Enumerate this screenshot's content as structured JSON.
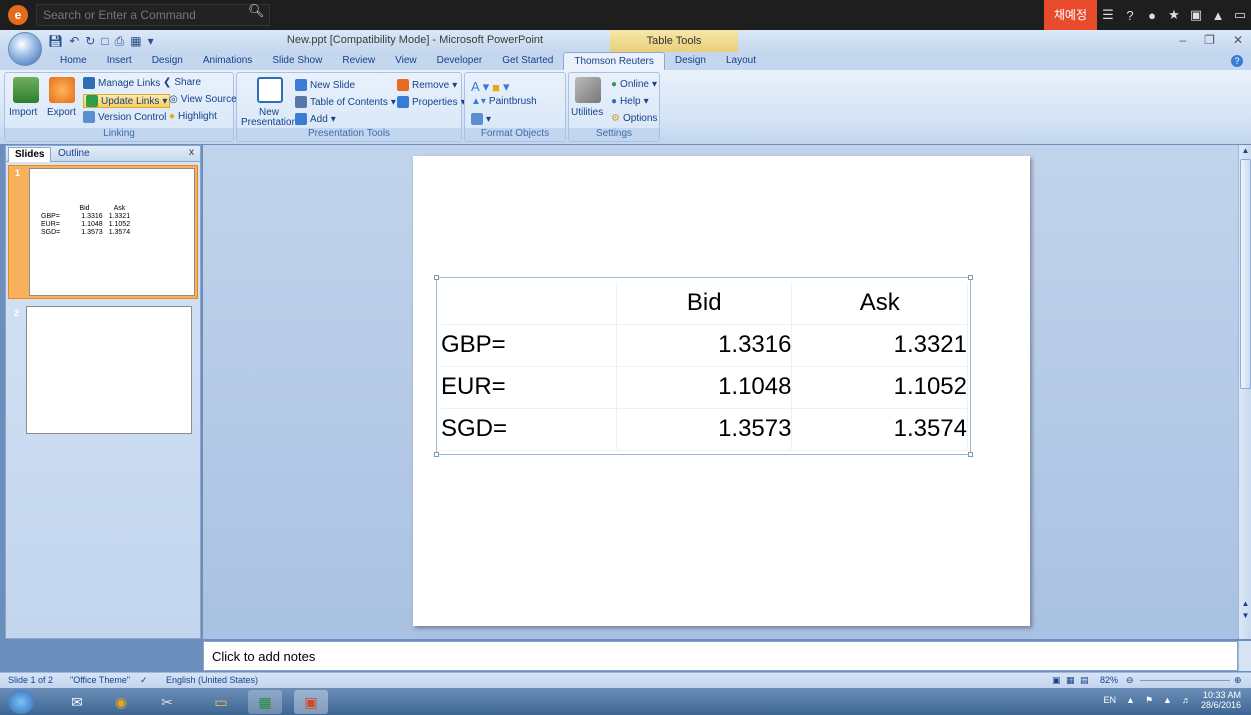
{
  "searchbar": {
    "placeholder": "Search or Enter a Command",
    "korean_button": "채예정"
  },
  "titlebar": {
    "title": "New.ppt [Compatibility Mode] - Microsoft PowerPoint",
    "context": "Table Tools"
  },
  "tabs": [
    "Home",
    "Insert",
    "Design",
    "Animations",
    "Slide Show",
    "Review",
    "View",
    "Developer",
    "Get Started",
    "Thomson Reuters",
    "Design",
    "Layout"
  ],
  "active_tab": "Thomson Reuters",
  "ribbon": {
    "linking": {
      "label": "Linking",
      "import": "Import",
      "export": "Export",
      "manage_links": "Manage Links",
      "share": "Share",
      "update_links": "Update Links",
      "view_source": "View Source",
      "version_control": "Version Control",
      "highlight": "Highlight"
    },
    "presentation_tools": {
      "label": "Presentation Tools",
      "new_presentation_1": "New",
      "new_presentation_2": "Presentation",
      "new_slide": "New Slide",
      "table_of_contents": "Table of Contents",
      "add": "Add",
      "remove": "Remove",
      "properties": "Properties"
    },
    "format_objects": {
      "label": "Format Objects",
      "paintbrush": "Paintbrush"
    },
    "settings": {
      "label": "Settings",
      "utilities": "Utilities",
      "online": "Online",
      "help": "Help",
      "options": "Options"
    }
  },
  "pane": {
    "tab_slides": "Slides",
    "tab_outline": "Outline",
    "close": "x",
    "slide1_num": "1",
    "slide2_num": "2"
  },
  "table": {
    "header": [
      "",
      "Bid",
      "Ask"
    ],
    "rows": [
      [
        "GBP=",
        "1.3316",
        "1.3321"
      ],
      [
        "EUR=",
        "1.1048",
        "1.1052"
      ],
      [
        "SGD=",
        "1.3573",
        "1.3574"
      ]
    ]
  },
  "notes_placeholder": "Click to add notes",
  "status": {
    "slide": "Slide 1 of 2",
    "theme": "\"Office Theme\"",
    "language": "English (United States)",
    "zoom": "82%"
  },
  "tray": {
    "lang": "EN",
    "time": "10:33 AM",
    "date": "28/6/2016"
  }
}
